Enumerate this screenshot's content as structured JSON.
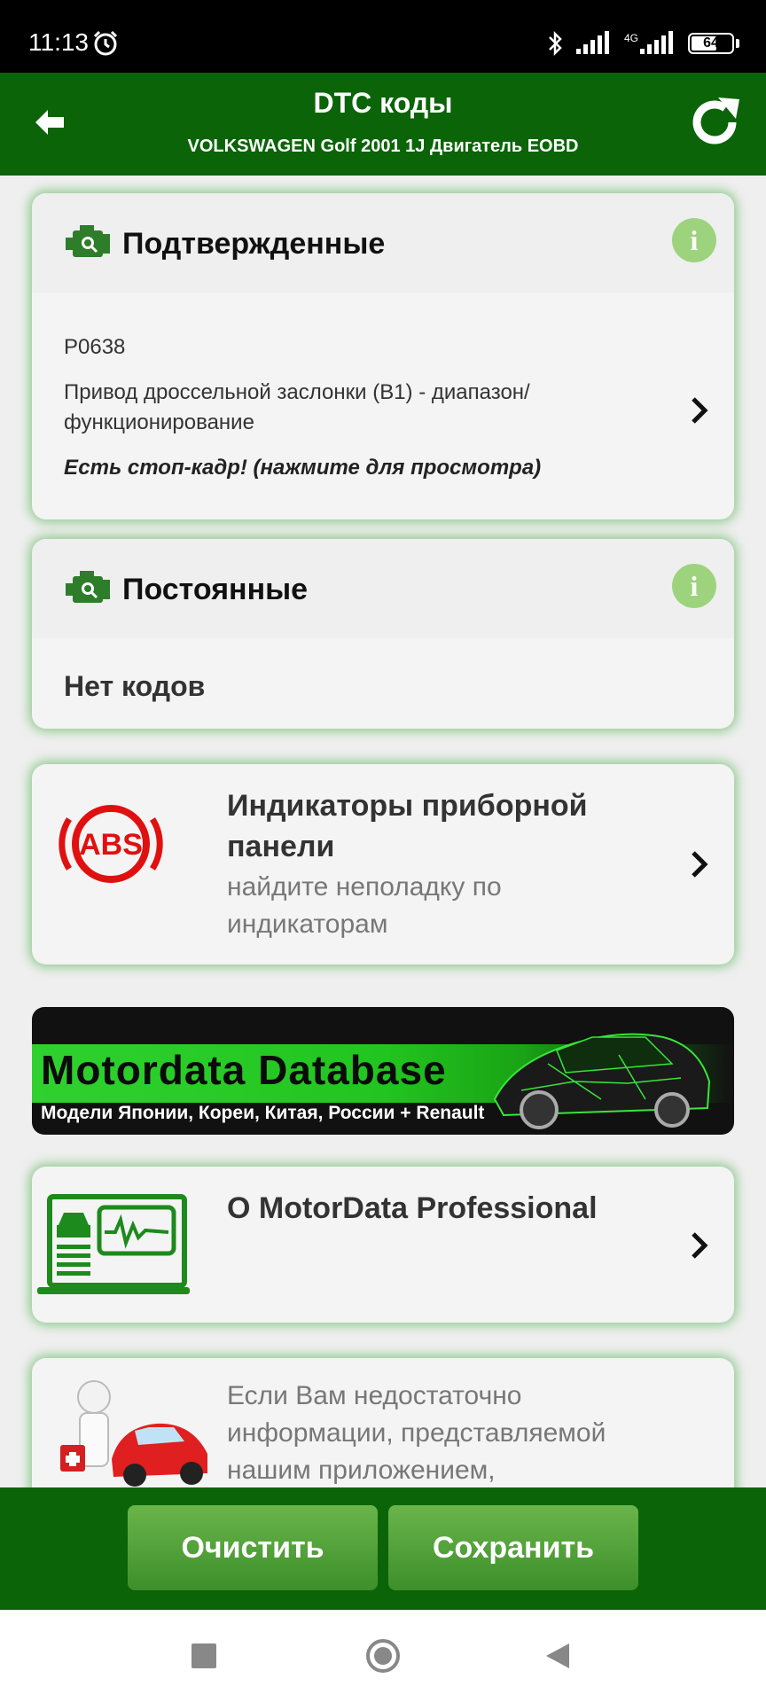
{
  "status": {
    "time": "11:13",
    "network": "4G",
    "battery": "64",
    "battery_level": 0.64
  },
  "header": {
    "title": "DTC коды",
    "subtitle": "VOLKSWAGEN Golf 2001 1J Двигатель EOBD"
  },
  "confirmed": {
    "title": "Подтвержденные",
    "code": "P0638",
    "description": "Привод дроссельной заслонки (B1) - диапазон/ функционирование",
    "freeze_frame": "Есть стоп-кадр! (нажмите для просмотра)"
  },
  "permanent": {
    "title": "Постоянные",
    "empty_text": "Нет кодов"
  },
  "indicators": {
    "title": "Индикаторы приборной панели",
    "subtitle": "найдите неполадку по индикаторам",
    "icon_text": "ABS"
  },
  "banner": {
    "title": "Motordata Database",
    "subtitle": "Модели Японии, Кореи, Китая, России + Renault"
  },
  "about": {
    "title": "О MotorData Professional"
  },
  "help": {
    "text": "Если Вам недостаточно информации, представляемой нашим приложением,"
  },
  "actions": {
    "clear": "Очистить",
    "save": "Сохранить"
  },
  "icons": {
    "back": "back-arrow-icon",
    "refresh": "refresh-icon",
    "info": "info-icon",
    "engine": "engine-check-icon",
    "chevron": "chevron-right-icon"
  },
  "colors": {
    "primary": "#0b6408",
    "accent": "#9ed37e",
    "button": "#4fa035"
  }
}
